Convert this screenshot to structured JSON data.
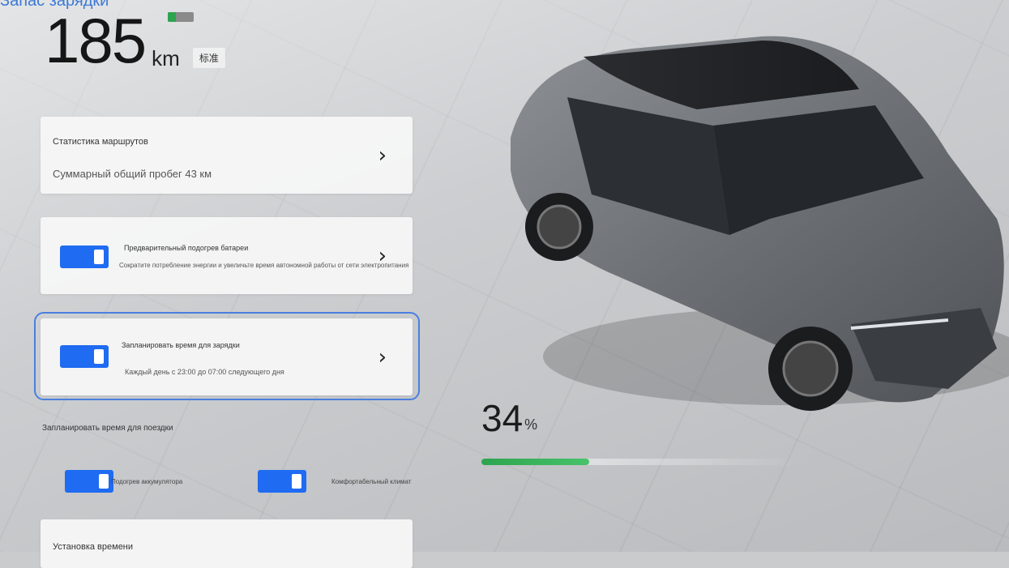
{
  "header": {
    "title": "Запас зарядки"
  },
  "range": {
    "value": "185",
    "unit": "km",
    "mode": "标准",
    "battery_level": 0.3
  },
  "cards": {
    "trip_stats": {
      "title": "Статистика маршрутов",
      "subtitle": "Суммарный общий пробег 43 км"
    },
    "preheat": {
      "title": "Предварительный подогрев батареи",
      "description": "Сократите потребление энергии и увеличьте время автономной работы от сети электропитания",
      "enabled": true
    },
    "charge_schedule": {
      "title": "Запланировать время для зарядки",
      "subtitle": "Каждый день с 23:00 до 07:00 следующего дня",
      "enabled": true
    }
  },
  "trip_section": {
    "label": "Запланировать время для поездки",
    "options": [
      {
        "label": "Подогрев аккумулятора",
        "enabled": true
      },
      {
        "label": "Комфортабельный климат",
        "enabled": true
      }
    ]
  },
  "time_setting": {
    "title": "Установка времени"
  },
  "battery": {
    "percent": "34",
    "unit": "%",
    "level": 0.34
  },
  "colors": {
    "accent": "#1f6bf2",
    "battery_green": "#2ea44f",
    "selection": "#4a7fe0"
  },
  "icons": {
    "chevron": "chevron-right-icon"
  }
}
